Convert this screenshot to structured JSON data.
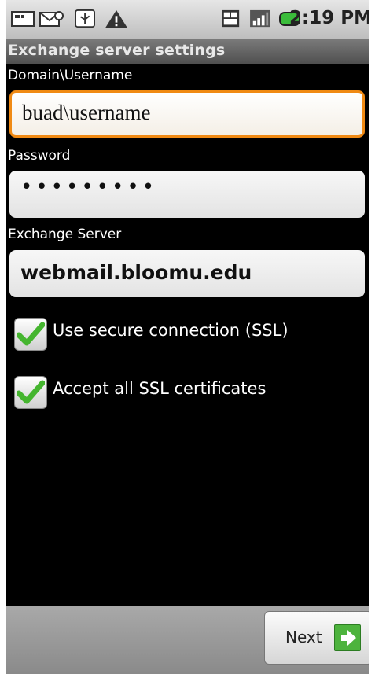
{
  "statusbar": {
    "time": "2:19 PM"
  },
  "titlebar": {
    "title": "Exchange server settings"
  },
  "form": {
    "domain_label": "Domain\\Username",
    "domain_value": "buad\\username",
    "password_label": "Password",
    "password_value": "•••••••••",
    "server_label": "Exchange Server",
    "server_value": "webmail.bloomu.edu",
    "ssl_label": "Use secure connection (SSL)",
    "ssl_checked": true,
    "accept_label": "Accept all SSL certificates",
    "accept_checked": true
  },
  "footer": {
    "next_label": "Next"
  },
  "colors": {
    "focus": "#f08a14",
    "check": "#45b52f",
    "next_arrow": "#4db33d"
  }
}
